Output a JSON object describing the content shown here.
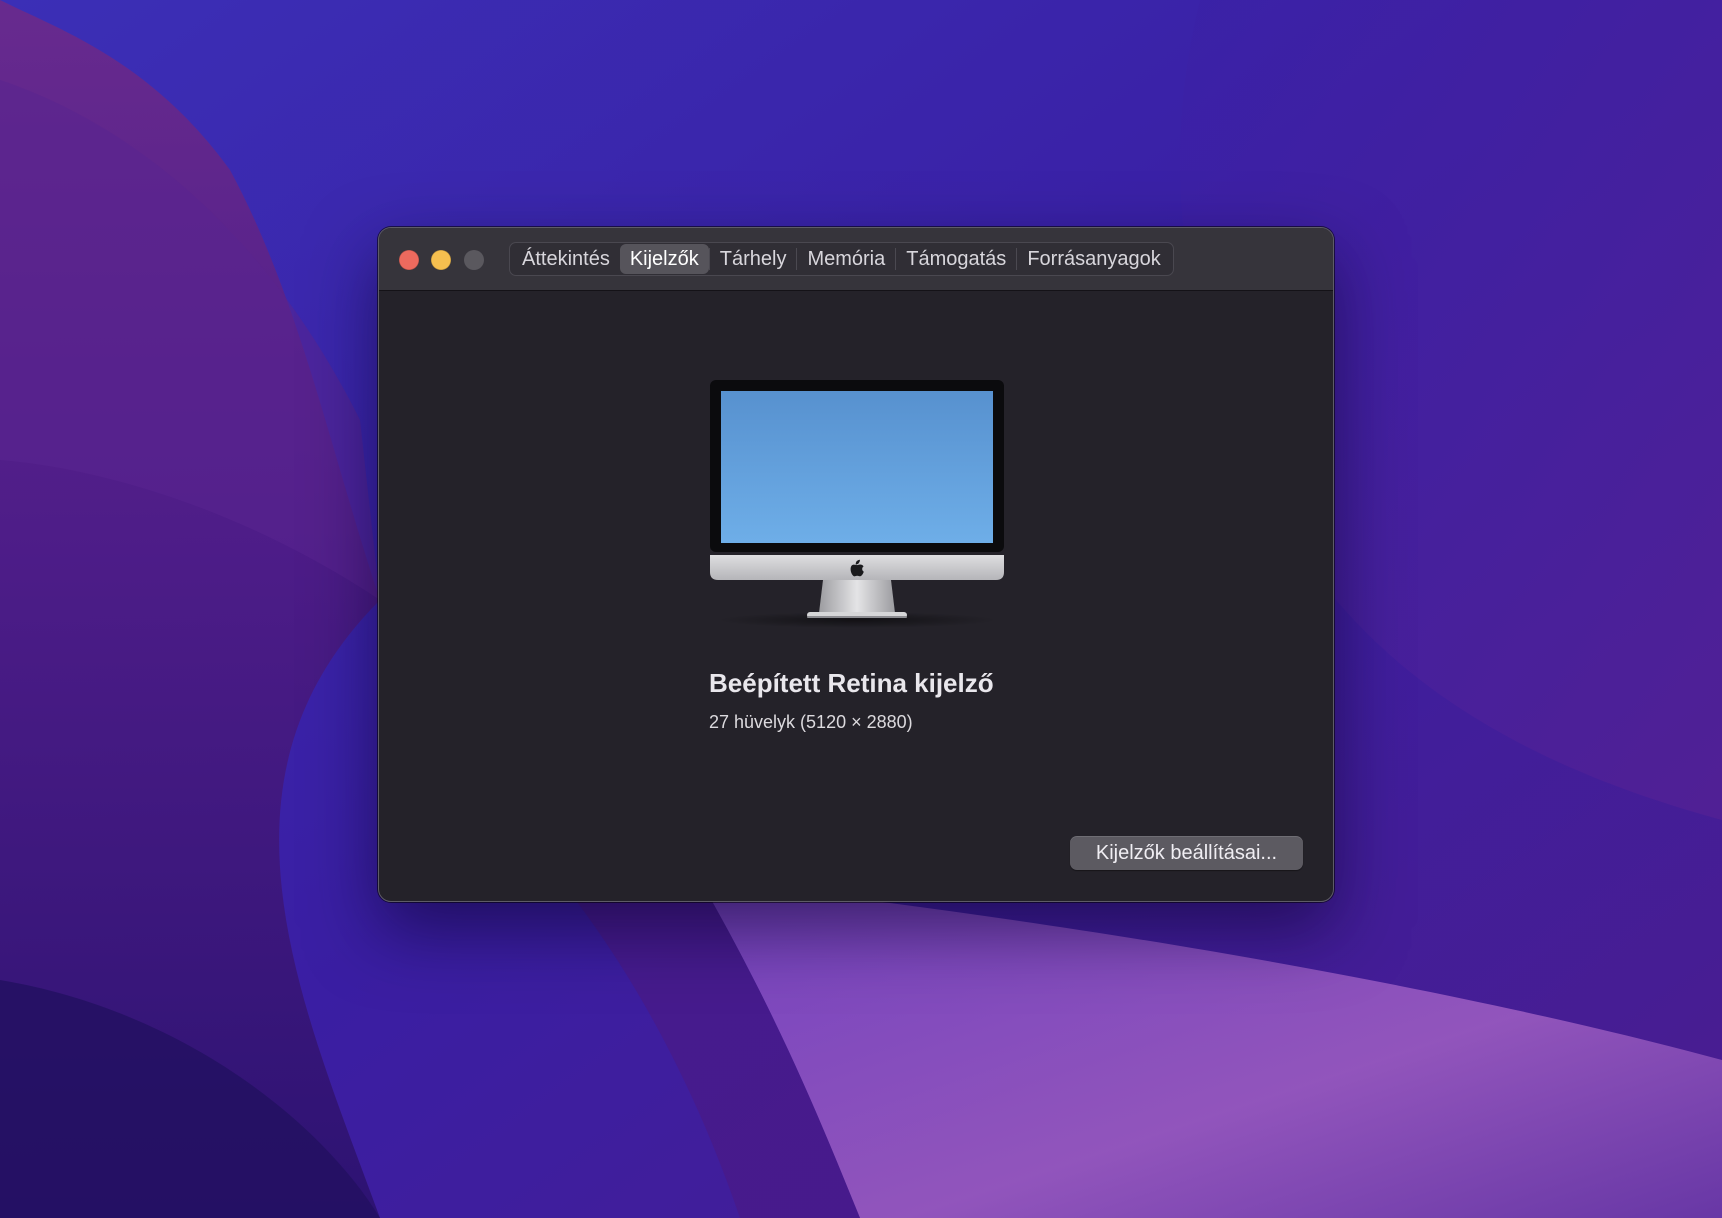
{
  "window": {
    "tabs": [
      {
        "label": "Áttekintés",
        "active": false
      },
      {
        "label": "Kijelzők",
        "active": true
      },
      {
        "label": "Tárhely",
        "active": false
      },
      {
        "label": "Memória",
        "active": false
      },
      {
        "label": "Támogatás",
        "active": false
      },
      {
        "label": "Forrásanyagok",
        "active": false
      }
    ],
    "traffic_lights": {
      "close_icon": "close-icon",
      "minimize_icon": "minimize-icon",
      "zoom_icon": "zoom-icon"
    }
  },
  "display": {
    "icon": "imac-icon",
    "name": "Beépített Retina kijelző",
    "details": "27 hüvelyk (5120 × 2880)"
  },
  "actions": {
    "settings_button": "Kijelzők beállításai..."
  },
  "colors": {
    "close": "#ed6a5e",
    "minimize": "#f5bf4f",
    "zoom_disabled": "#5a585e",
    "window_bg": "#242229",
    "titlebar_bg": "#36343b"
  }
}
